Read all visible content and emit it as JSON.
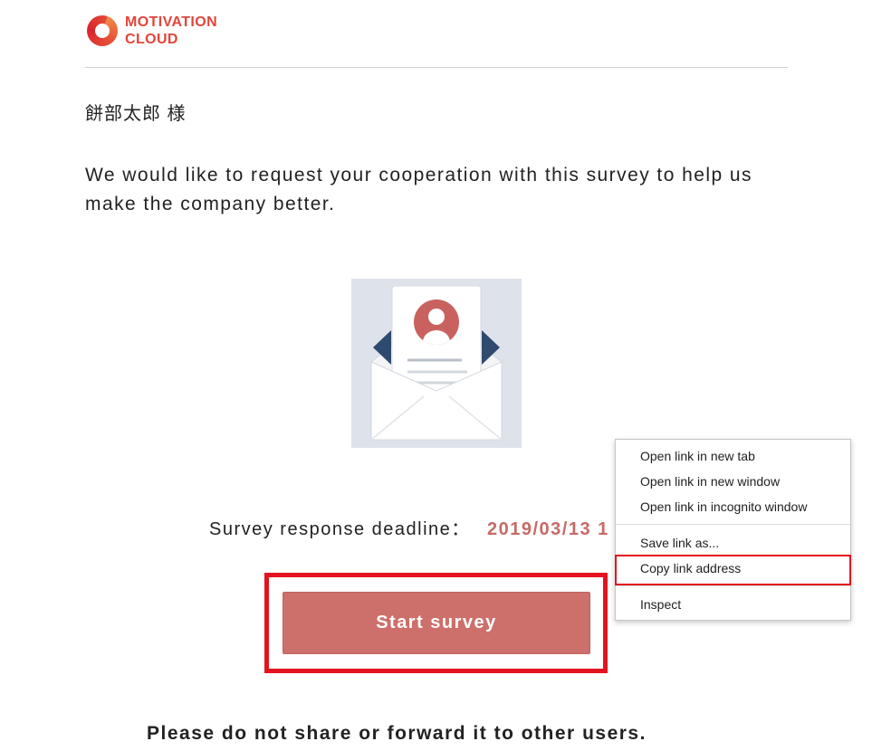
{
  "colors": {
    "brand": "#e2453a",
    "text": "#222222",
    "deadline_value": "#c76a67",
    "button_bg": "#cd6f6b",
    "annotation": "#e3141f"
  },
  "logo": {
    "icon": "motivation-cloud-ring-logo",
    "line1": "MOTIVATION",
    "line2": "CLOUD"
  },
  "email": {
    "greeting": "餅部太郎 様",
    "message": "We would like to request your cooperation with this survey to help us make the company better.",
    "illustration_icon": "envelope-letter-illustration",
    "deadline_label": "Survey response deadline：",
    "deadline_value": "2019/03/13 1",
    "start_button": {
      "label": "Start survey",
      "highlighted": true
    },
    "notice": "Please do not share or forward it to other users."
  },
  "context_menu": {
    "groups": [
      [
        {
          "label": "Open link in new tab"
        },
        {
          "label": "Open link in new window"
        },
        {
          "label": "Open link in incognito window"
        }
      ],
      [
        {
          "label": "Save link as..."
        },
        {
          "label": "Copy link address",
          "highlighted": true
        }
      ],
      [
        {
          "label": "Inspect"
        }
      ]
    ]
  }
}
